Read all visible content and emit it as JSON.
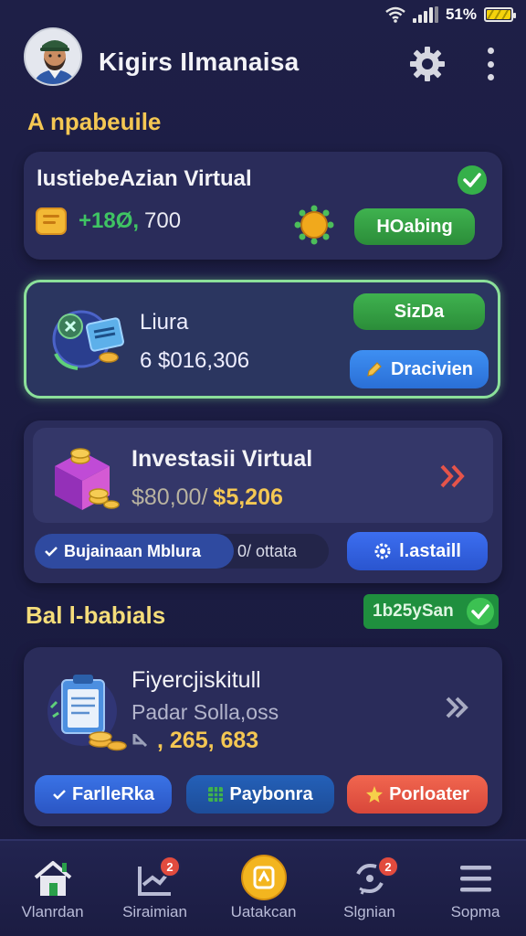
{
  "status_bar": {
    "battery": "51%"
  },
  "header": {
    "title": "Kigirs Ilmanaisa"
  },
  "section1": {
    "title": "A npabeuile"
  },
  "card1": {
    "title": "lustiebeAzian Virtual",
    "amount_highlight": "+18Ø,",
    "amount_rest": "700",
    "button": "HOabing"
  },
  "card2": {
    "title": "Liura",
    "amount": "6 $016,306",
    "badge": "SizDa",
    "button": "Dracivien"
  },
  "card3": {
    "title": "Investasii Virtual",
    "amount_left": "$80,00/",
    "amount_right": "$5,206",
    "toggle_active": "Bujainaan Mblura",
    "toggle_inactive": "0/ ottata",
    "button": "l.astaill"
  },
  "section2": {
    "title": "Bal l-babials",
    "badge": "1b25ySan"
  },
  "card4": {
    "title": "Fiyercjiskitull",
    "line1": "Padar  Solla,oss",
    "amount": ", 265, 683",
    "buttons": [
      "FarlleRka",
      "Paybonra",
      "Porloater"
    ]
  },
  "nav": {
    "items": [
      {
        "label": "Vlanrdan",
        "icon": "home-icon"
      },
      {
        "label": "Siraimian",
        "icon": "chart-icon",
        "badge": "2"
      },
      {
        "label": "Uatakcan",
        "icon": "coin-icon"
      },
      {
        "label": "Slgnian",
        "icon": "refresh-icon",
        "badge": "2"
      },
      {
        "label": "Sopma",
        "icon": "menu-icon"
      }
    ]
  },
  "colors": {
    "accent_gold": "#f4c753",
    "green": "#3fb24f",
    "blue": "#3e8ff2",
    "red": "#f1664f",
    "bg": "#1e1f47"
  }
}
